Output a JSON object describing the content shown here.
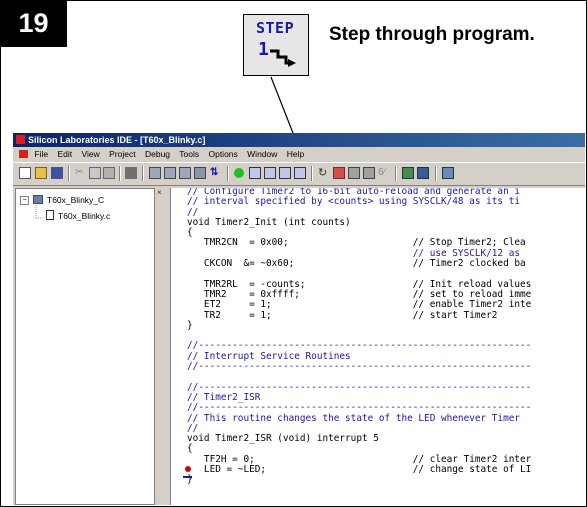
{
  "step": {
    "number": "19",
    "heading": "Step through program."
  },
  "step_icon": {
    "label": "STEP",
    "digit": "1"
  },
  "ide": {
    "title": "Silicon Laboratories IDE - [T60x_Blinky.c]",
    "menu": [
      "File",
      "Edit",
      "View",
      "Project",
      "Debug",
      "Tools",
      "Options",
      "Window",
      "Help"
    ],
    "project_tree": {
      "project": "T60x_Blinky_C",
      "file": "T60x_Blinky.c"
    },
    "code_lines": [
      {
        "t": "// Configure Timer2 to 16-bit auto-reload and generate an i",
        "c": true
      },
      {
        "t": "// interval specified by <counts> using SYSCLK/48 as its ti",
        "c": true
      },
      {
        "t": "//",
        "c": true
      },
      {
        "t": "void Timer2_Init (int counts)",
        "c": false
      },
      {
        "t": "{",
        "c": false
      },
      {
        "t": "   TMR2CN  = 0x00;                      // Stop Timer2; Clea",
        "c": false
      },
      {
        "t": "                                        // use SYSCLK/12 as ",
        "c": true
      },
      {
        "t": "   CKCON  &= ~0x60;                     // Timer2 clocked ba",
        "c": false
      },
      {
        "t": "",
        "c": false
      },
      {
        "t": "   TMR2RL  = -counts;                   // Init reload values",
        "c": false
      },
      {
        "t": "   TMR2    = 0xffff;                    // set to reload imme",
        "c": false
      },
      {
        "t": "   ET2     = 1;                         // enable Timer2 inte",
        "c": false
      },
      {
        "t": "   TR2     = 1;                         // start Timer2",
        "c": false
      },
      {
        "t": "}",
        "c": false
      },
      {
        "t": "",
        "c": false
      },
      {
        "t": "//-----------------------------------------------------------",
        "c": true
      },
      {
        "t": "// Interrupt Service Routines",
        "c": true
      },
      {
        "t": "//-----------------------------------------------------------",
        "c": true
      },
      {
        "t": "",
        "c": false
      },
      {
        "t": "//-----------------------------------------------------------",
        "c": true
      },
      {
        "t": "// Timer2_ISR",
        "c": true
      },
      {
        "t": "//-----------------------------------------------------------",
        "c": true
      },
      {
        "t": "// This routine changes the state of the LED whenever Timer",
        "c": true
      },
      {
        "t": "//",
        "c": true
      },
      {
        "t": "void Timer2_ISR (void) interrupt 5",
        "c": false
      },
      {
        "t": "{",
        "c": false
      },
      {
        "t": "   TF2H = 0;                            // clear Timer2 inter",
        "c": false
      },
      {
        "t": "   LED = ~LED;                          // change state of LI",
        "c": false
      },
      {
        "t": "}",
        "c": false
      }
    ]
  }
}
